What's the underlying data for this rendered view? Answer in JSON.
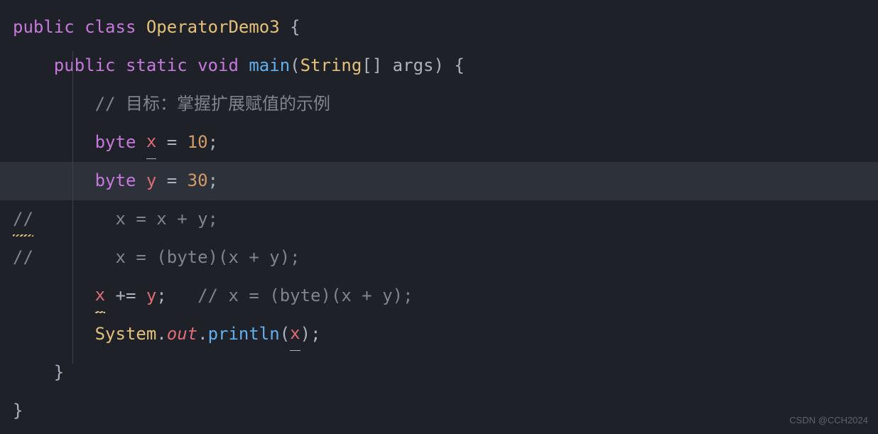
{
  "code": {
    "line1": {
      "public": "public",
      "class": "class",
      "className": "OperatorDemo3",
      "brace": " {"
    },
    "line2": {
      "indent": "    ",
      "public": "public",
      "static": "static",
      "void": "void",
      "methodName": "main",
      "openParen": "(",
      "paramType": "String",
      "brackets": "[]",
      "space": " ",
      "paramName": "args",
      "closeParen": ")",
      "brace": " {"
    },
    "line3": {
      "indent": "        ",
      "comment": "// 目标：掌握扩展赋值的示例"
    },
    "line4": {
      "indent": "        ",
      "type": "byte",
      "space": " ",
      "var": "x",
      "assignEq": " = ",
      "value": "10",
      "semi": ";"
    },
    "line5": {
      "indent": "        ",
      "type": "byte",
      "space": " ",
      "var": "y",
      "assignEq": " = ",
      "value": "30",
      "semi": ";"
    },
    "line6": {
      "slashes": "//",
      "spacing": "        ",
      "content": "x = x + y;"
    },
    "line7": {
      "slashes": "//",
      "spacing": "        ",
      "content": "x = (byte)(x + y);"
    },
    "line8": {
      "indent": "        ",
      "var": "x",
      "op": " += ",
      "var2": "y",
      "semi": ";",
      "gap": "   ",
      "comment": "// x = (byte)(x + y);"
    },
    "line9": {
      "indent": "        ",
      "system": "System",
      "dot1": ".",
      "out": "out",
      "dot2": ".",
      "method": "println",
      "openParen": "(",
      "arg": "x",
      "closeParen": ")",
      "semi": ";"
    },
    "line10": {
      "indent": "    ",
      "brace": "}"
    },
    "line11": {
      "brace": "}"
    }
  },
  "watermark": "CSDN @CCH2024"
}
